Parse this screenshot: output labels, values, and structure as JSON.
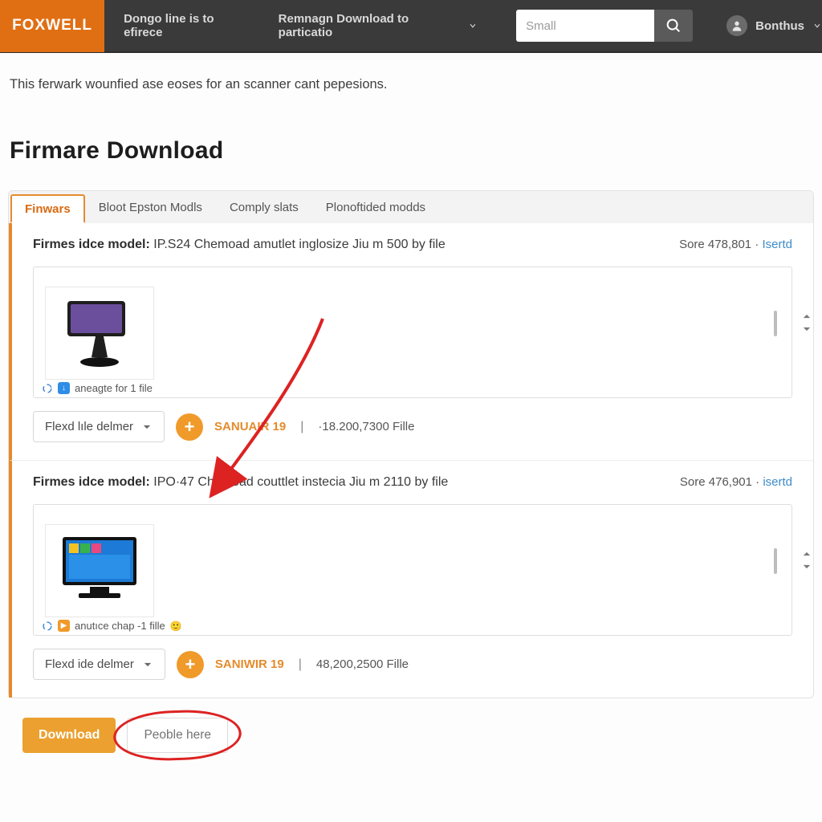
{
  "brand": {
    "name": "FOXWELL"
  },
  "nav": {
    "item1": "Dongo line is to efirece",
    "item2": "Remnagn Download to particatio"
  },
  "search": {
    "placeholder": "Small"
  },
  "user": {
    "name": "Bonthus"
  },
  "intro": "This ferwark wounfied ase eoses for an scanner cant pepesions.",
  "page_title": "Firmare Download",
  "tabs": {
    "t0": "Finwars",
    "t1": "Bloot Epston Modls",
    "t2": "Comply slats",
    "t3": "Plonoftided modds"
  },
  "entries": [
    {
      "title_lead": "Firmes idce model:",
      "title_rest": " IP.S24 Chemoad amutlet inglosize Jiu m 500 by file",
      "meta_lead": "Sore 478,801 · ",
      "meta_link": "Isertd",
      "preview_caption": "aneagte for 1 file",
      "dropdown": "Flexd lıle delmer",
      "foot_link": "SANUAIR 19",
      "foot_text": "·18.200,7300 Fille"
    },
    {
      "title_lead": "Firmes idce model:",
      "title_rest": " IPO·47 Chemoad couttlet instecia Jiu m 2110 by file",
      "meta_lead": "Sore 476,901 · ",
      "meta_link": "isertd",
      "preview_caption": "anutıce chap -1 fille",
      "dropdown": "Flexd ide delmer",
      "foot_link": "SANIWIR 19",
      "foot_text": "48,200,2500 Fille"
    }
  ],
  "bottom": {
    "download": "Download",
    "secondary": "Peoble here"
  }
}
